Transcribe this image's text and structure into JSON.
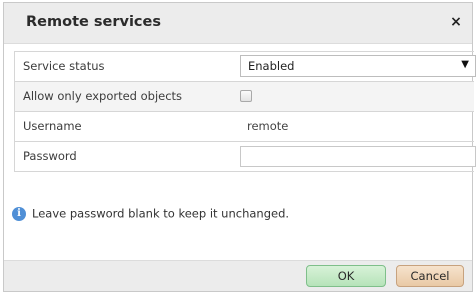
{
  "dialog": {
    "title": "Remote services",
    "close_glyph": "×"
  },
  "form": {
    "rows": [
      {
        "label": "Service status",
        "type": "select",
        "value": "Enabled",
        "arrow_glyph": "▼"
      },
      {
        "label": "Allow only exported objects",
        "type": "checkbox",
        "checked": false
      },
      {
        "label": "Username",
        "type": "text",
        "value": "remote"
      },
      {
        "label": "Password",
        "type": "password",
        "value": ""
      }
    ]
  },
  "info": {
    "icon": "info-icon",
    "icon_glyph": "i",
    "text": "Leave password blank to keep it unchanged.",
    "color": "#4f8fd6"
  },
  "buttons": {
    "ok_label": "OK",
    "cancel_label": "Cancel"
  },
  "colors": {
    "ok_button": "#b6e3b9",
    "cancel_button": "#e9c9a5"
  }
}
